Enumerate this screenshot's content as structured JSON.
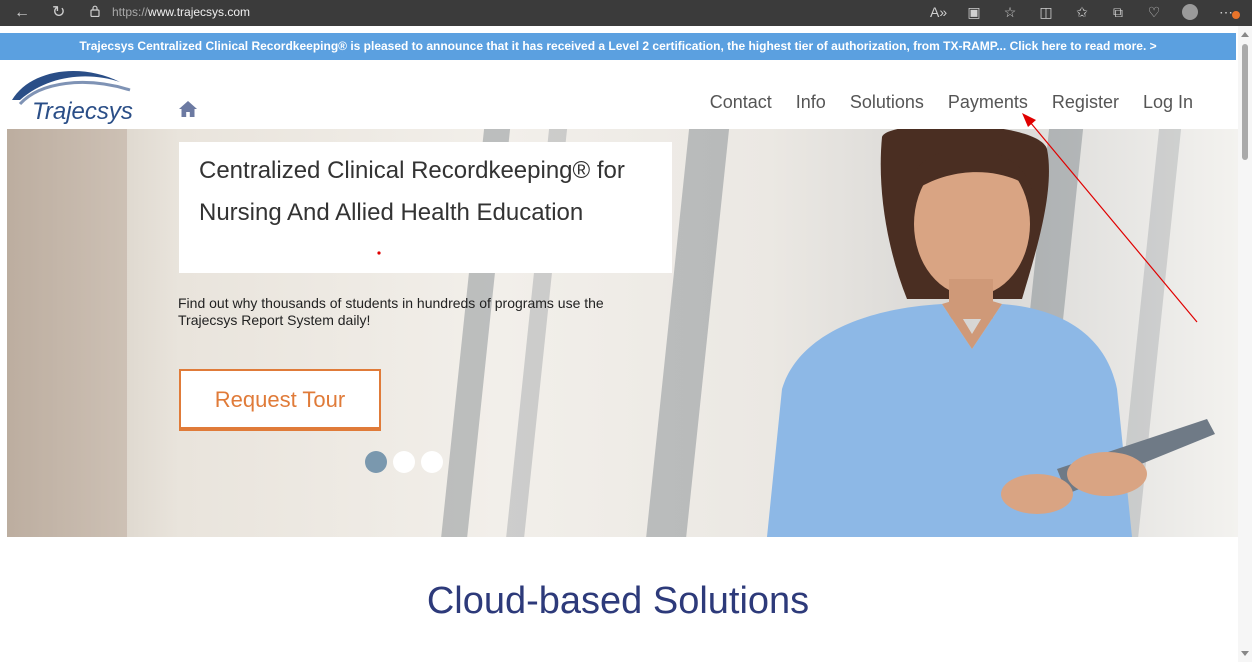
{
  "browser": {
    "url_protocol": "https://",
    "url_host": "www.trajecsys.com",
    "icons": [
      "back-icon",
      "refresh-icon",
      "lock-icon",
      "read-aloud-icon",
      "immersive-reader-icon",
      "favorite-icon",
      "split-screen-icon",
      "favorites-list-icon",
      "collections-icon",
      "health-icon",
      "profile-icon",
      "more-icon"
    ]
  },
  "announcement": {
    "text": "Trajecsys Centralized Clinical Recordkeeping® is pleased to announce that it has received a Level 2 certification, the highest tier of authorization, from TX-RAMP... Click here to read more. >"
  },
  "header": {
    "logo_text": "Trajecsys",
    "nav": [
      "Contact",
      "Info",
      "Solutions",
      "Payments",
      "Register",
      "Log In"
    ]
  },
  "hero": {
    "headline": "Centralized Clinical Recordkeeping® for Nursing And Allied Health Education",
    "tagline": "Find out why thousands of students in hundreds of programs use the Trajecsys Report System daily!",
    "cta": "Request Tour",
    "slides": 3,
    "active_slide": 1
  },
  "section": {
    "title": "Cloud-based Solutions"
  },
  "colors": {
    "announcement_bg": "#5ba0e0",
    "brand_blue": "#2a4e87",
    "cta_orange": "#e07b39",
    "section_title": "#2d3a7a",
    "annotation_red": "#e00000"
  }
}
